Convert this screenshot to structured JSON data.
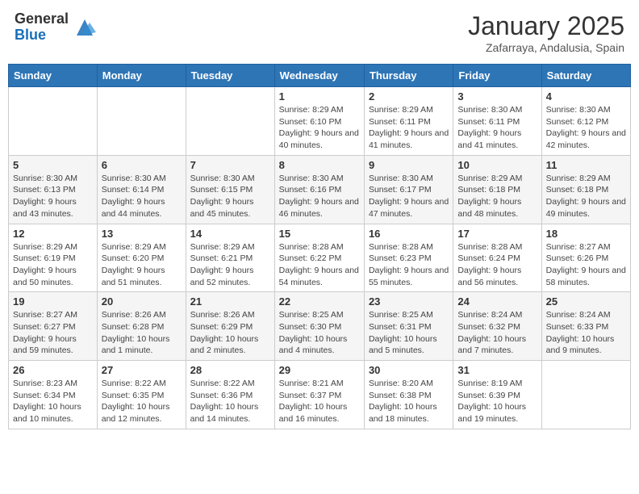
{
  "header": {
    "logo": {
      "general": "General",
      "blue": "Blue"
    },
    "title": "January 2025",
    "location": "Zafarraya, Andalusia, Spain"
  },
  "days_of_week": [
    "Sunday",
    "Monday",
    "Tuesday",
    "Wednesday",
    "Thursday",
    "Friday",
    "Saturday"
  ],
  "weeks": [
    [
      null,
      null,
      null,
      {
        "num": "1",
        "sunrise": "8:29 AM",
        "sunset": "6:10 PM",
        "daylight": "9 hours and 40 minutes."
      },
      {
        "num": "2",
        "sunrise": "8:29 AM",
        "sunset": "6:11 PM",
        "daylight": "9 hours and 41 minutes."
      },
      {
        "num": "3",
        "sunrise": "8:30 AM",
        "sunset": "6:11 PM",
        "daylight": "9 hours and 41 minutes."
      },
      {
        "num": "4",
        "sunrise": "8:30 AM",
        "sunset": "6:12 PM",
        "daylight": "9 hours and 42 minutes."
      }
    ],
    [
      {
        "num": "5",
        "sunrise": "8:30 AM",
        "sunset": "6:13 PM",
        "daylight": "9 hours and 43 minutes."
      },
      {
        "num": "6",
        "sunrise": "8:30 AM",
        "sunset": "6:14 PM",
        "daylight": "9 hours and 44 minutes."
      },
      {
        "num": "7",
        "sunrise": "8:30 AM",
        "sunset": "6:15 PM",
        "daylight": "9 hours and 45 minutes."
      },
      {
        "num": "8",
        "sunrise": "8:30 AM",
        "sunset": "6:16 PM",
        "daylight": "9 hours and 46 minutes."
      },
      {
        "num": "9",
        "sunrise": "8:30 AM",
        "sunset": "6:17 PM",
        "daylight": "9 hours and 47 minutes."
      },
      {
        "num": "10",
        "sunrise": "8:29 AM",
        "sunset": "6:18 PM",
        "daylight": "9 hours and 48 minutes."
      },
      {
        "num": "11",
        "sunrise": "8:29 AM",
        "sunset": "6:18 PM",
        "daylight": "9 hours and 49 minutes."
      }
    ],
    [
      {
        "num": "12",
        "sunrise": "8:29 AM",
        "sunset": "6:19 PM",
        "daylight": "9 hours and 50 minutes."
      },
      {
        "num": "13",
        "sunrise": "8:29 AM",
        "sunset": "6:20 PM",
        "daylight": "9 hours and 51 minutes."
      },
      {
        "num": "14",
        "sunrise": "8:29 AM",
        "sunset": "6:21 PM",
        "daylight": "9 hours and 52 minutes."
      },
      {
        "num": "15",
        "sunrise": "8:28 AM",
        "sunset": "6:22 PM",
        "daylight": "9 hours and 54 minutes."
      },
      {
        "num": "16",
        "sunrise": "8:28 AM",
        "sunset": "6:23 PM",
        "daylight": "9 hours and 55 minutes."
      },
      {
        "num": "17",
        "sunrise": "8:28 AM",
        "sunset": "6:24 PM",
        "daylight": "9 hours and 56 minutes."
      },
      {
        "num": "18",
        "sunrise": "8:27 AM",
        "sunset": "6:26 PM",
        "daylight": "9 hours and 58 minutes."
      }
    ],
    [
      {
        "num": "19",
        "sunrise": "8:27 AM",
        "sunset": "6:27 PM",
        "daylight": "9 hours and 59 minutes."
      },
      {
        "num": "20",
        "sunrise": "8:26 AM",
        "sunset": "6:28 PM",
        "daylight": "10 hours and 1 minute."
      },
      {
        "num": "21",
        "sunrise": "8:26 AM",
        "sunset": "6:29 PM",
        "daylight": "10 hours and 2 minutes."
      },
      {
        "num": "22",
        "sunrise": "8:25 AM",
        "sunset": "6:30 PM",
        "daylight": "10 hours and 4 minutes."
      },
      {
        "num": "23",
        "sunrise": "8:25 AM",
        "sunset": "6:31 PM",
        "daylight": "10 hours and 5 minutes."
      },
      {
        "num": "24",
        "sunrise": "8:24 AM",
        "sunset": "6:32 PM",
        "daylight": "10 hours and 7 minutes."
      },
      {
        "num": "25",
        "sunrise": "8:24 AM",
        "sunset": "6:33 PM",
        "daylight": "10 hours and 9 minutes."
      }
    ],
    [
      {
        "num": "26",
        "sunrise": "8:23 AM",
        "sunset": "6:34 PM",
        "daylight": "10 hours and 10 minutes."
      },
      {
        "num": "27",
        "sunrise": "8:22 AM",
        "sunset": "6:35 PM",
        "daylight": "10 hours and 12 minutes."
      },
      {
        "num": "28",
        "sunrise": "8:22 AM",
        "sunset": "6:36 PM",
        "daylight": "10 hours and 14 minutes."
      },
      {
        "num": "29",
        "sunrise": "8:21 AM",
        "sunset": "6:37 PM",
        "daylight": "10 hours and 16 minutes."
      },
      {
        "num": "30",
        "sunrise": "8:20 AM",
        "sunset": "6:38 PM",
        "daylight": "10 hours and 18 minutes."
      },
      {
        "num": "31",
        "sunrise": "8:19 AM",
        "sunset": "6:39 PM",
        "daylight": "10 hours and 19 minutes."
      },
      null
    ]
  ]
}
